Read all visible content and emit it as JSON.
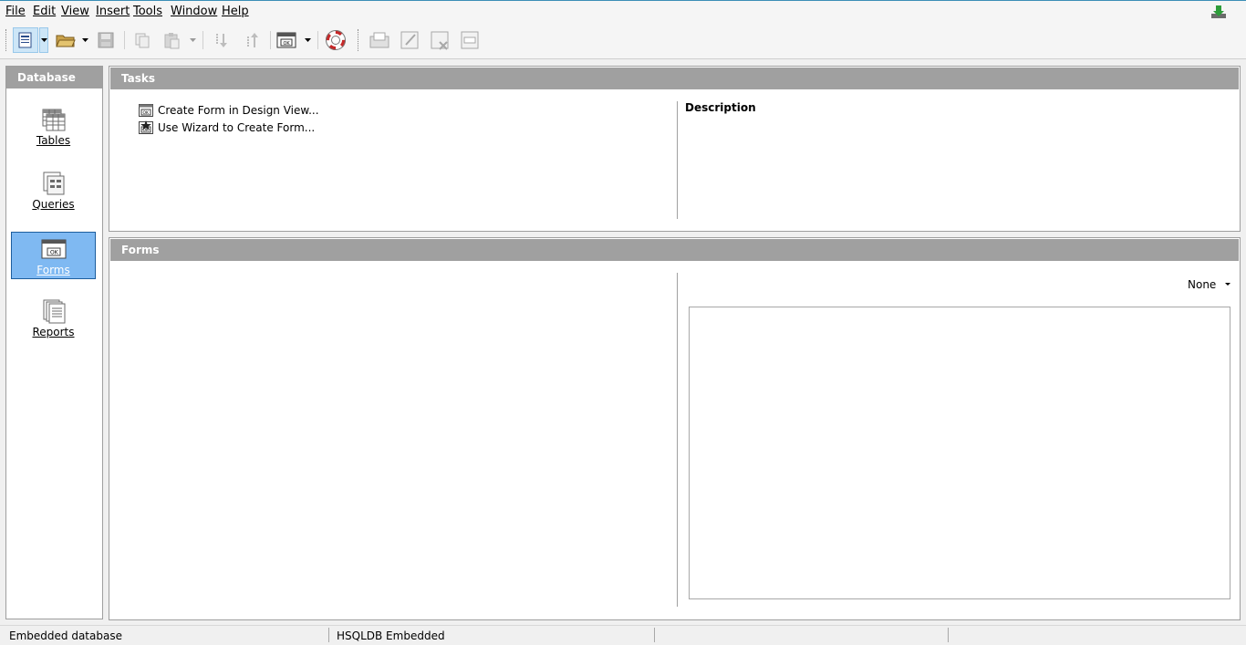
{
  "menu": {
    "file": "File",
    "edit": "Edit",
    "view": "View",
    "insert": "Insert",
    "tools": "Tools",
    "window": "Window",
    "help": "Help"
  },
  "toolbar": {
    "icons": [
      "new-document-icon",
      "dropdown-arrow-icon",
      "open-folder-icon",
      "save-icon",
      "copy-icon",
      "paste-icon",
      "sort-ascending-icon",
      "sort-descending-icon",
      "form-icon",
      "help-lifebuoy-icon",
      "open-object-icon",
      "edit-object-icon",
      "delete-object-icon",
      "rename-object-icon"
    ]
  },
  "database_panel": {
    "header": "Database",
    "items": [
      {
        "label": "Tables",
        "icon": "tables-icon"
      },
      {
        "label": "Queries",
        "icon": "queries-icon"
      },
      {
        "label": "Forms",
        "icon": "forms-icon",
        "selected": true
      },
      {
        "label": "Reports",
        "icon": "reports-icon"
      }
    ]
  },
  "tasks": {
    "header": "Tasks",
    "items": [
      {
        "label": "Create Form in Design View..."
      },
      {
        "label": "Use Wizard to Create Form..."
      }
    ],
    "description_title": "Description"
  },
  "forms": {
    "header": "Forms",
    "preview_mode": "None"
  },
  "status": {
    "left": "Embedded database",
    "middle": "HSQLDB Embedded"
  },
  "colors": {
    "header_gray": "#a0a0a0",
    "selection_blue": "#7fb9f2",
    "selection_border": "#1d5e9e"
  }
}
